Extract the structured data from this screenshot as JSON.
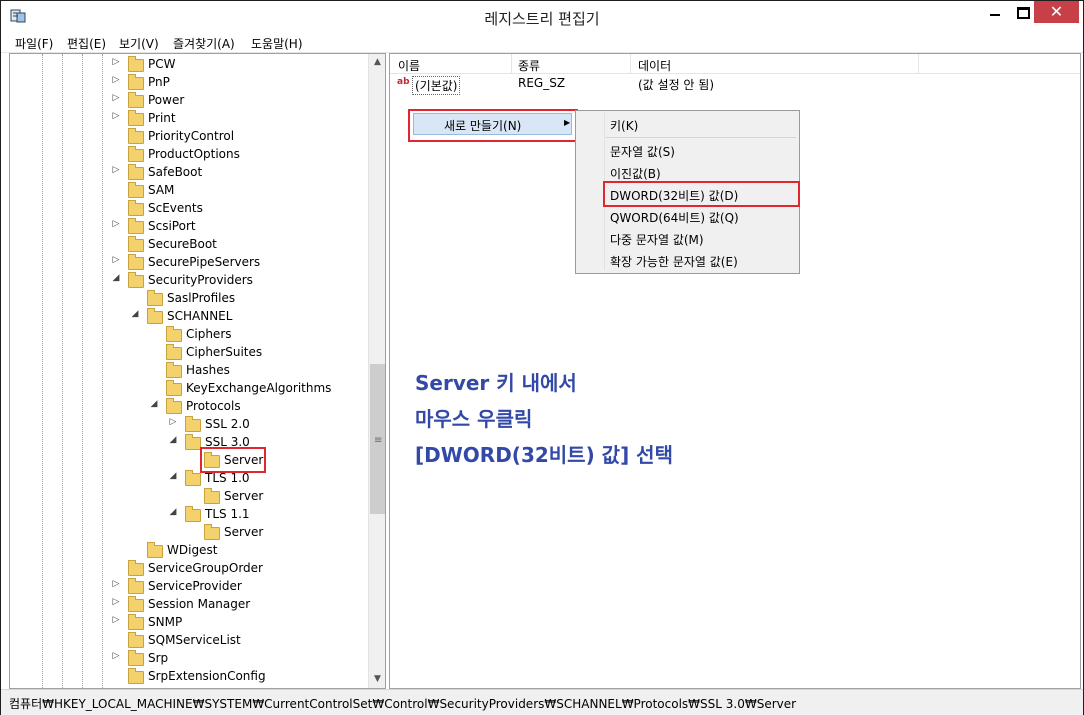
{
  "window": {
    "title": "레지스트리 편집기"
  },
  "menubar": [
    "파일(F)",
    "편집(E)",
    "보기(V)",
    "즐겨찾기(A)",
    "도움말(H)"
  ],
  "tree": [
    {
      "label": "PCW",
      "indent": 0,
      "expander": "▷"
    },
    {
      "label": "PnP",
      "indent": 0,
      "expander": "▷"
    },
    {
      "label": "Power",
      "indent": 0,
      "expander": "▷"
    },
    {
      "label": "Print",
      "indent": 0,
      "expander": "▷"
    },
    {
      "label": "PriorityControl",
      "indent": 0,
      "expander": ""
    },
    {
      "label": "ProductOptions",
      "indent": 0,
      "expander": ""
    },
    {
      "label": "SafeBoot",
      "indent": 0,
      "expander": "▷"
    },
    {
      "label": "SAM",
      "indent": 0,
      "expander": ""
    },
    {
      "label": "ScEvents",
      "indent": 0,
      "expander": ""
    },
    {
      "label": "ScsiPort",
      "indent": 0,
      "expander": "▷"
    },
    {
      "label": "SecureBoot",
      "indent": 0,
      "expander": ""
    },
    {
      "label": "SecurePipeServers",
      "indent": 0,
      "expander": "▷"
    },
    {
      "label": "SecurityProviders",
      "indent": 0,
      "expander": "◢"
    },
    {
      "label": "SaslProfiles",
      "indent": 1,
      "expander": ""
    },
    {
      "label": "SCHANNEL",
      "indent": 1,
      "expander": "◢"
    },
    {
      "label": "Ciphers",
      "indent": 2,
      "expander": ""
    },
    {
      "label": "CipherSuites",
      "indent": 2,
      "expander": ""
    },
    {
      "label": "Hashes",
      "indent": 2,
      "expander": ""
    },
    {
      "label": "KeyExchangeAlgorithms",
      "indent": 2,
      "expander": ""
    },
    {
      "label": "Protocols",
      "indent": 2,
      "expander": "◢"
    },
    {
      "label": "SSL 2.0",
      "indent": 3,
      "expander": "▷"
    },
    {
      "label": "SSL 3.0",
      "indent": 3,
      "expander": "◢"
    },
    {
      "label": "Server",
      "indent": 4,
      "expander": ""
    },
    {
      "label": "TLS 1.0",
      "indent": 3,
      "expander": "◢"
    },
    {
      "label": "Server",
      "indent": 4,
      "expander": ""
    },
    {
      "label": "TLS 1.1",
      "indent": 3,
      "expander": "◢"
    },
    {
      "label": "Server",
      "indent": 4,
      "expander": ""
    },
    {
      "label": "WDigest",
      "indent": 1,
      "expander": ""
    },
    {
      "label": "ServiceGroupOrder",
      "indent": 0,
      "expander": ""
    },
    {
      "label": "ServiceProvider",
      "indent": 0,
      "expander": "▷"
    },
    {
      "label": "Session Manager",
      "indent": 0,
      "expander": "▷"
    },
    {
      "label": "SNMP",
      "indent": 0,
      "expander": "▷"
    },
    {
      "label": "SQMServiceList",
      "indent": 0,
      "expander": ""
    },
    {
      "label": "Srp",
      "indent": 0,
      "expander": "▷"
    },
    {
      "label": "SrpExtensionConfig",
      "indent": 0,
      "expander": ""
    }
  ],
  "list": {
    "columns": [
      "이름",
      "종류",
      "데이터"
    ],
    "rows": [
      {
        "icon": "ab",
        "name": "(기본값)",
        "type": "REG_SZ",
        "data": "(값 설정 안 됨)"
      }
    ]
  },
  "context_menu": {
    "new_label": "새로 만들기(N)"
  },
  "submenu": [
    "키(K)",
    "문자열 값(S)",
    "이진값(B)",
    "DWORD(32비트) 값(D)",
    "QWORD(64비트) 값(Q)",
    "다중 문자열 값(M)",
    "확장 가능한 문자열 값(E)"
  ],
  "annotation": [
    "Server 키 내에서",
    "마우스 우클릭",
    "[DWORD(32비트) 값] 선택"
  ],
  "status": "컴퓨터₩HKEY_LOCAL_MACHINE₩SYSTEM₩CurrentControlSet₩Control₩SecurityProviders₩SCHANNEL₩Protocols₩SSL 3.0₩Server",
  "colors": {
    "highlight_box": "#e0262e",
    "annotation_text": "#3349a8",
    "folder": "#f3d16d"
  }
}
